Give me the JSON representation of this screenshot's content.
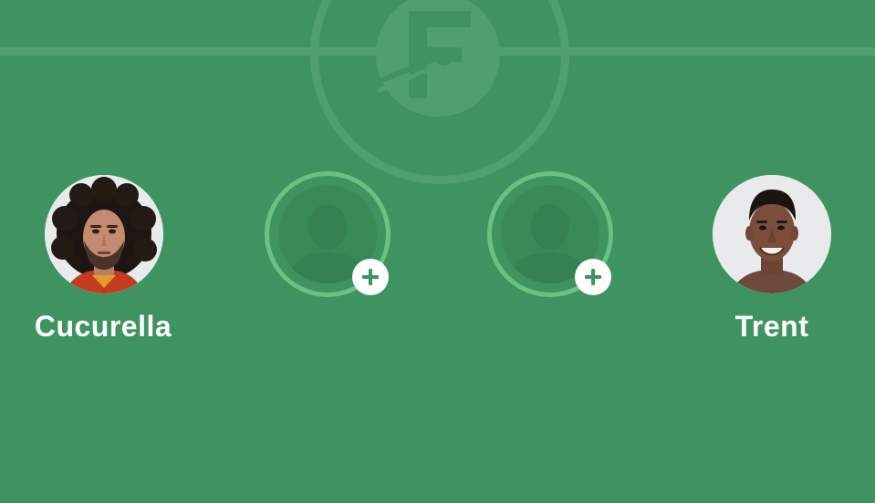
{
  "pitch": {
    "background_color": "#3f9360",
    "line_color": "#4fa06e",
    "accent_ring_color": "#6ac27f",
    "center_logo_icon": "futbin-logo-icon"
  },
  "players": [
    {
      "name": "Cucurella",
      "state": "filled",
      "photo_icon": "player-photo-cucurella"
    },
    {
      "name": "",
      "state": "empty",
      "silhouette_icon": "player-silhouette-icon",
      "action_icon": "plus-icon"
    },
    {
      "name": "",
      "state": "empty",
      "silhouette_icon": "player-silhouette-icon",
      "action_icon": "plus-icon"
    },
    {
      "name": "Trent",
      "state": "filled",
      "photo_icon": "player-photo-trent"
    }
  ]
}
